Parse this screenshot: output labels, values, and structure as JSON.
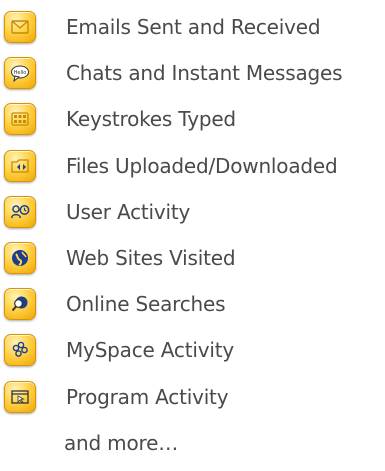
{
  "features": [
    {
      "label": "Emails Sent and Received",
      "icon": "envelope-icon"
    },
    {
      "label": "Chats and Instant Messages",
      "icon": "chat-bubble-icon",
      "icon_text": "Hello"
    },
    {
      "label": "Keystrokes Typed",
      "icon": "keyboard-icon"
    },
    {
      "label": "Files Uploaded/Downloaded",
      "icon": "folder-transfer-icon"
    },
    {
      "label": "User Activity",
      "icon": "user-clock-icon"
    },
    {
      "label": "Web Sites Visited",
      "icon": "globe-icon"
    },
    {
      "label": "Online Searches",
      "icon": "magnifier-globe-icon"
    },
    {
      "label": "MySpace Activity",
      "icon": "people-group-icon"
    },
    {
      "label": "Program Activity",
      "icon": "program-window-icon"
    }
  ],
  "more_label": "and more…",
  "colors": {
    "text": "#4a4a4a",
    "icon_tile": "#ffd24a",
    "icon_ink": "#1a3f8f"
  }
}
